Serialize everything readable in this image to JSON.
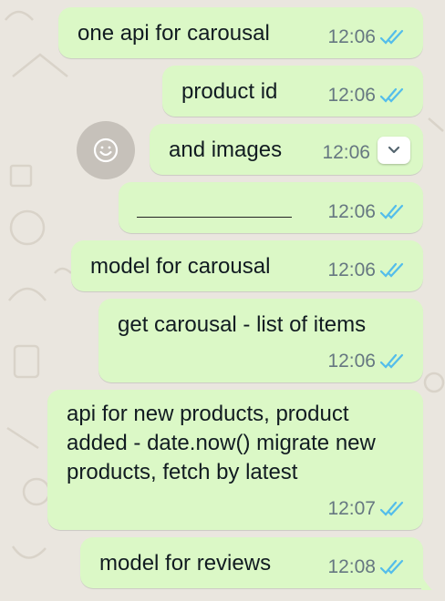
{
  "colors": {
    "bubble": "#dbf8c6",
    "read_ticks": "#53bdeb",
    "background": "#eae6df",
    "meta_text": "#667781"
  },
  "messages": [
    {
      "text": "one api for carousal",
      "time": "12:06",
      "status": "read"
    },
    {
      "text": "product id",
      "time": "12:06",
      "status": "read"
    },
    {
      "text": "and images",
      "time": "12:06",
      "status": "menu",
      "hover_action": "chevron-down-icon"
    },
    {
      "text": "",
      "time": "12:06",
      "status": "read",
      "content": "horizontal-rule"
    },
    {
      "text": "model for carousal",
      "time": "12:06",
      "status": "read"
    },
    {
      "text": "get carousal - list of items",
      "time": "12:06",
      "status": "read"
    },
    {
      "text": "api for new products, product added - date.now() migrate new products, fetch by latest",
      "time": "12:07",
      "status": "read"
    },
    {
      "text": "model for reviews",
      "time": "12:08",
      "status": "read"
    }
  ],
  "emoji_button": {
    "icon": "smiley-icon"
  }
}
